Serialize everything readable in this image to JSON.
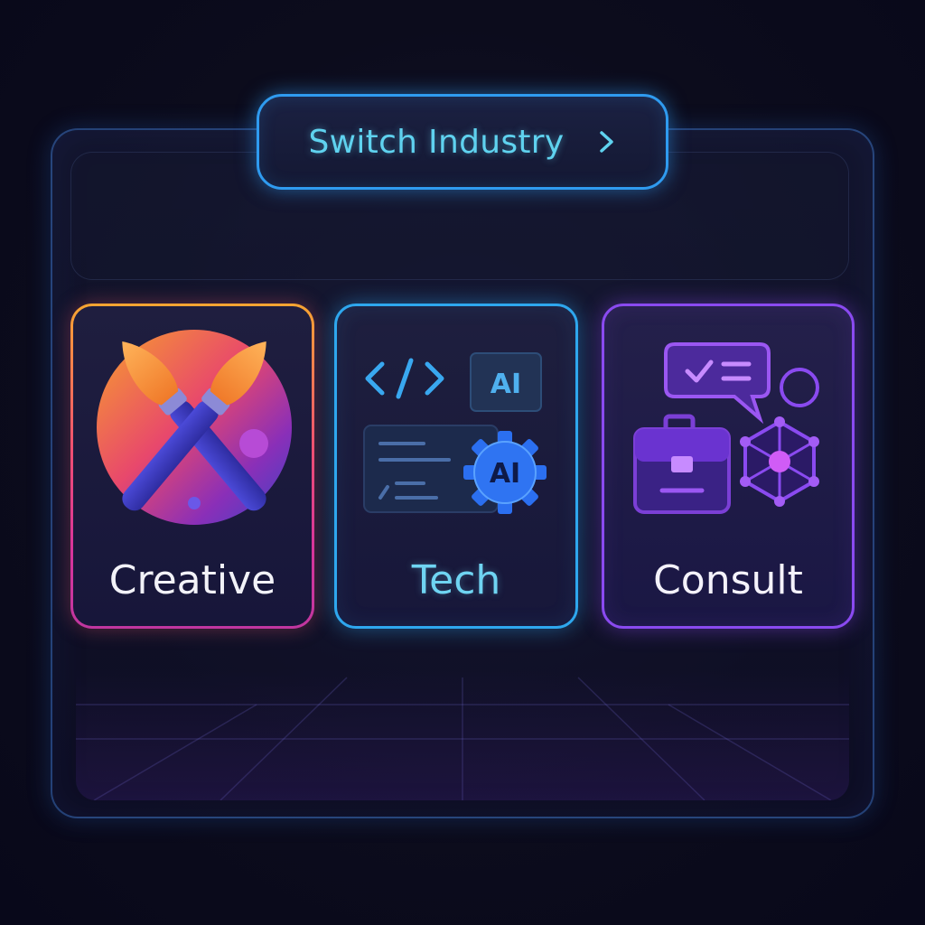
{
  "header": {
    "switch_label": "Switch Industry",
    "chevron_icon": "chevron-right-icon"
  },
  "industries": [
    {
      "label": "Creative",
      "icon": "paintbrushes-icon",
      "accent": "#f06a4a"
    },
    {
      "label": "Tech",
      "icon": "code-ai-icon",
      "accent": "#2ea7ee",
      "badges": [
        "AI",
        "AI"
      ]
    },
    {
      "label": "Consult",
      "icon": "briefcase-network-icon",
      "accent": "#8a4af0"
    }
  ],
  "colors": {
    "background": "#0c0c1c",
    "panel_border": "#386ebe",
    "switch_border": "#2f9bf0",
    "switch_text": "#5fd2ef"
  }
}
